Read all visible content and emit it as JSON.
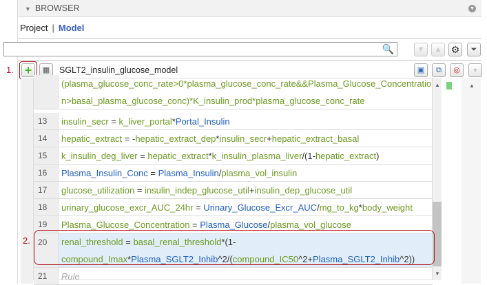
{
  "browser": {
    "title": "BROWSER"
  },
  "tabs": {
    "project": "Project",
    "separator": "|",
    "model": "Model"
  },
  "search": {
    "value": "",
    "placeholder": ""
  },
  "model": {
    "name": "SGLT2_insulin_glucose_model"
  },
  "annotations": {
    "one": "1.",
    "two": "2."
  },
  "rows": [
    {
      "num": "",
      "lines": [
        [
          [
            "(plasma_glucose_conc_rate>0*plasma_glucose_conc_rate&&Plasma_Glucose_Concentratio",
            "g"
          ]
        ],
        [
          [
            "n>basal_plasma_glucose_conc)*K_insulin_prod*plasma_glucose_conc_rate",
            "g"
          ]
        ]
      ]
    },
    {
      "num": "13",
      "lines": [
        [
          [
            "insulin_secr",
            "g"
          ],
          [
            " = ",
            "o"
          ],
          [
            "k_liver_portal",
            "g"
          ],
          [
            "*",
            "o"
          ],
          [
            "Portal_Insulin",
            "b"
          ]
        ]
      ]
    },
    {
      "num": "14",
      "lines": [
        [
          [
            "hepatic_extract",
            "g"
          ],
          [
            " = -",
            "o"
          ],
          [
            "hepatic_extract_dep",
            "g"
          ],
          [
            "*",
            "o"
          ],
          [
            "insulin_secr",
            "g"
          ],
          [
            "+",
            "o"
          ],
          [
            "hepatic_extract_basal",
            "g"
          ]
        ]
      ]
    },
    {
      "num": "15",
      "lines": [
        [
          [
            "k_insulin_deg_liver",
            "g"
          ],
          [
            " = ",
            "o"
          ],
          [
            "hepatic_extract",
            "g"
          ],
          [
            "*",
            "o"
          ],
          [
            "k_insulin_plasma_liver",
            "g"
          ],
          [
            "/(1-",
            "o"
          ],
          [
            "hepatic_extract",
            "g"
          ],
          [
            ")",
            "o"
          ]
        ]
      ]
    },
    {
      "num": "16",
      "lines": [
        [
          [
            "Plasma_Insulin_Conc",
            "b"
          ],
          [
            " = ",
            "o"
          ],
          [
            "Plasma_Insulin",
            "b"
          ],
          [
            "/",
            "o"
          ],
          [
            "plasma_vol_insulin",
            "g"
          ]
        ]
      ]
    },
    {
      "num": "17",
      "lines": [
        [
          [
            "glucose_utilization",
            "g"
          ],
          [
            " = ",
            "o"
          ],
          [
            "insulin_indep_glucose_util",
            "g"
          ],
          [
            "+",
            "o"
          ],
          [
            "insulin_dep_glucose_util",
            "g"
          ]
        ]
      ]
    },
    {
      "num": "18",
      "lines": [
        [
          [
            "urinary_glucose_excr_AUC_24hr",
            "g"
          ],
          [
            " = ",
            "o"
          ],
          [
            "Urinary_Glucose_Excr_AUC",
            "b"
          ],
          [
            "/",
            "o"
          ],
          [
            "mg_to_kg",
            "g"
          ],
          [
            "*",
            "o"
          ],
          [
            "body_weight",
            "g"
          ]
        ]
      ]
    },
    {
      "num": "19",
      "lines": [
        [
          [
            "Plasma_Glucose_Concentration",
            "g"
          ],
          [
            " = ",
            "o"
          ],
          [
            "Plasma_Glucose",
            "b"
          ],
          [
            "/",
            "o"
          ],
          [
            "plasma_vol_glucose",
            "g"
          ]
        ]
      ]
    },
    {
      "num": "20",
      "lines": [
        [
          [
            "renal_threshold",
            "g"
          ],
          [
            " = ",
            "o"
          ],
          [
            "basal_renal_threshold",
            "g"
          ],
          [
            "*(1-",
            "o"
          ]
        ],
        [
          [
            "compound_Imax",
            "g"
          ],
          [
            "*",
            "o"
          ],
          [
            "Plasma_SGLT2_Inhib",
            "b"
          ],
          [
            "^2/(",
            "o"
          ],
          [
            "compound_IC50",
            "g"
          ],
          [
            "^2+",
            "o"
          ],
          [
            "Plasma_SGLT2_Inhib",
            "b"
          ],
          [
            "^2))",
            "o"
          ]
        ]
      ]
    },
    {
      "num": "21",
      "lines": [
        [
          [
            "Rule",
            "ph"
          ]
        ]
      ]
    }
  ],
  "colors": {
    "variable": "#6c9a22",
    "species": "#1f5fbf",
    "annotation": "#b0141e",
    "selected_row": "#e1eef9"
  }
}
